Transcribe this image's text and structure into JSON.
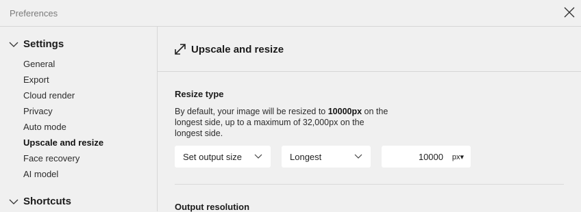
{
  "window": {
    "title": "Preferences"
  },
  "sidebar": {
    "sections": [
      {
        "label": "Settings"
      },
      {
        "label": "Shortcuts"
      }
    ],
    "items": [
      {
        "label": "General"
      },
      {
        "label": "Export"
      },
      {
        "label": "Cloud render"
      },
      {
        "label": "Privacy"
      },
      {
        "label": "Auto mode"
      },
      {
        "label": "Upscale and resize"
      },
      {
        "label": "Face recovery"
      },
      {
        "label": "AI model"
      }
    ],
    "active_item": "Upscale and resize"
  },
  "main": {
    "title": "Upscale and resize",
    "title_icon": "expand-arrow-icon",
    "resize": {
      "heading": "Resize type",
      "desc_before": "By default, your image will be resized to ",
      "desc_bold": "10000px",
      "desc_after": " on the longest side, up to a maximum of 32,000px on the longest side.",
      "mode_value": "Set output size",
      "side_value": "Longest",
      "size_value": "10000",
      "unit_value": "px▾"
    },
    "output": {
      "heading": "Output resolution"
    }
  },
  "colors": {
    "background": "#f0f0f0",
    "field": "#ffffff",
    "divider": "#d6d6d6"
  }
}
